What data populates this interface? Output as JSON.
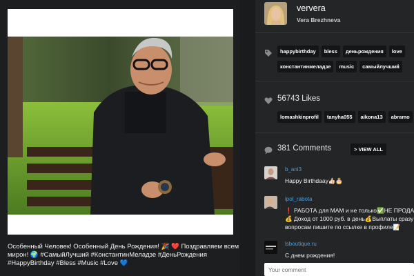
{
  "post": {
    "caption_lines": [
      "Особенный Человек! Особенный День Рождения! 🎉 ❤️ Поздравляем всем",
      "мирон! 🌍 #СамыйЛучший #КонстантинМеладзе #ДеньРождения",
      "#HappyBirthday #Bless #Music #Love 💙"
    ]
  },
  "profile": {
    "username": "ververa",
    "full_name": "Vera Brezhneva"
  },
  "tags": [
    "happybirthday",
    "bless",
    "деньрождения",
    "love",
    "константинмеладзе",
    "music",
    "самыйлучший"
  ],
  "likes": {
    "label": "56743 Likes",
    "users": [
      "lomashkinprofil",
      "tanyha055",
      "aikona13",
      "abramo"
    ]
  },
  "comments": {
    "label": "381 Comments",
    "view_all": "> VIEW ALL",
    "items": [
      {
        "user": "b_ani3",
        "lines": [
          "Happy Birthdaay👍🏻🎂"
        ]
      },
      {
        "user": "ipol_rabota",
        "lines": [
          "❗ РАБОТА для МАМ и не только✅НЕ ПРОДАЖ",
          "💰 Доход от 1000 руб. в день💰Выплаты сразу",
          "вопросам пишите по ссылке в профиле📝"
        ]
      },
      {
        "user": "lsboutique.ru",
        "lines": [
          "С днем рождения!"
        ]
      }
    ],
    "input_placeholder": "Your comment"
  },
  "icons": {
    "tag": "tag-icon",
    "heart": "heart-icon",
    "comment": "speech-bubble-icon"
  },
  "colors": {
    "link": "#4a9fe0",
    "panel": "#232526",
    "chip": "#141516"
  }
}
